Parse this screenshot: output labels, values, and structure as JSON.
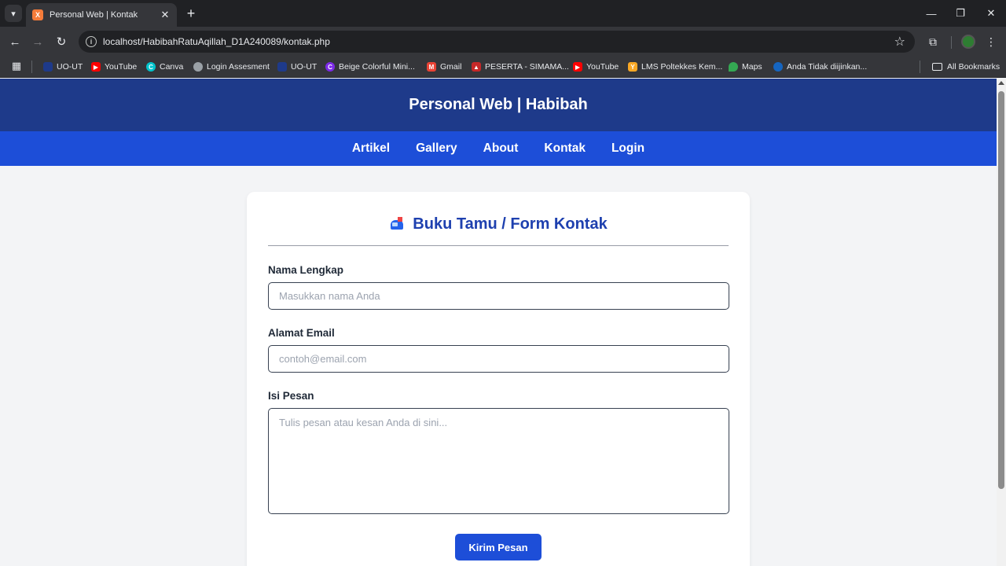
{
  "browser": {
    "tab": {
      "title": "Personal Web | Kontak",
      "favicon": "xampp-icon"
    },
    "url": "localhost/HabibahRatuAqillah_D1A240089/kontak.php",
    "bookmarks": [
      {
        "label": "UO-UT",
        "icon": "ut-icon",
        "color": "#1e3a8a"
      },
      {
        "label": "YouTube",
        "icon": "youtube-icon",
        "color": "#ff0000"
      },
      {
        "label": "Canva",
        "icon": "canva-icon",
        "color": "#00c4cc"
      },
      {
        "label": "Login Assesment",
        "icon": "globe-icon",
        "color": "#9aa0a6"
      },
      {
        "label": "UO-UT",
        "icon": "ut-icon",
        "color": "#1e3a8a"
      },
      {
        "label": "Beige Colorful Mini...",
        "icon": "canva-icon",
        "color": "#7d2ae8"
      },
      {
        "label": "Gmail",
        "icon": "gmail-icon",
        "color": "#ea4335"
      },
      {
        "label": "PESERTA - SIMAMA...",
        "icon": "simama-icon",
        "color": "#c62828"
      },
      {
        "label": "YouTube",
        "icon": "youtube-icon",
        "color": "#ff0000"
      },
      {
        "label": "LMS Poltekkes Kem...",
        "icon": "lms-icon",
        "color": "#f9a825"
      },
      {
        "label": "Maps",
        "icon": "maps-icon",
        "color": "#34a853"
      },
      {
        "label": "Anda Tidak diijinkan...",
        "icon": "kemdikbud-icon",
        "color": "#1565c0"
      }
    ],
    "all_bookmarks": "All Bookmarks"
  },
  "site": {
    "title": "Personal Web | Habibah",
    "nav": [
      "Artikel",
      "Gallery",
      "About",
      "Kontak",
      "Login"
    ]
  },
  "form": {
    "heading": "Buku Tamu / Form Kontak",
    "name_label": "Nama Lengkap",
    "name_placeholder": "Masukkan nama Anda",
    "email_label": "Alamat Email",
    "email_placeholder": "contoh@email.com",
    "message_label": "Isi Pesan",
    "message_placeholder": "Tulis pesan atau kesan Anda di sini...",
    "submit": "Kirim Pesan"
  },
  "colors": {
    "header_bg": "#1e3a8a",
    "nav_bg": "#1d4ed8",
    "accent": "#1d4ed8",
    "heading": "#1e40af"
  }
}
